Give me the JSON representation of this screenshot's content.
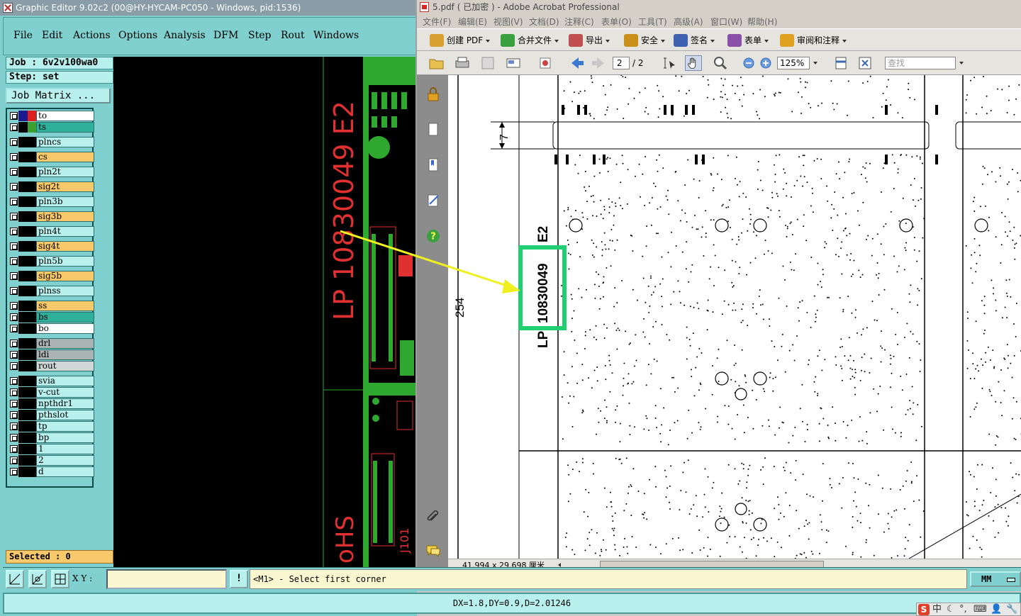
{
  "ge": {
    "title": "Graphic Editor 9.02c2 (00@HY-HYCAM-PC050 - Windows, pid:1536)",
    "menu": [
      {
        "label": "File",
        "name": "menu-file"
      },
      {
        "label": "Edit",
        "name": "menu-edit"
      },
      {
        "label": "Actions",
        "name": "menu-actions"
      },
      {
        "label": "Options",
        "name": "menu-options"
      },
      {
        "label": "Analysis",
        "name": "menu-analysis"
      },
      {
        "label": "DFM",
        "name": "menu-dfm"
      },
      {
        "label": "Step",
        "name": "menu-step"
      },
      {
        "label": "Rout",
        "name": "menu-rout"
      },
      {
        "label": "Windows",
        "name": "menu-windows"
      }
    ],
    "job_label": "Job : 6v2v100wa0",
    "step_label": "Step: set",
    "job_matrix_button": "Job Matrix ...",
    "layers": [
      {
        "name": "to",
        "bg": "#ffffff",
        "sw1": "#1a1a8c",
        "sw2": "#e02020"
      },
      {
        "name": "ts",
        "bg": "#2fb09a",
        "sw1": "#000000",
        "sw2": "#3aa030"
      },
      {
        "name": "plncs",
        "bg": "#b8f0ee",
        "sw1": "#000000",
        "sw2": "#000000"
      },
      {
        "name": "cs",
        "bg": "#f8c96a",
        "sw1": "#000000",
        "sw2": "#000000"
      },
      {
        "name": "pln2t",
        "bg": "#b8f0ee",
        "sw1": "#000000",
        "sw2": "#000000"
      },
      {
        "name": "sig2t",
        "bg": "#f8c96a",
        "sw1": "#000000",
        "sw2": "#000000"
      },
      {
        "name": "pln3b",
        "bg": "#b8f0ee",
        "sw1": "#000000",
        "sw2": "#000000"
      },
      {
        "name": "sig3b",
        "bg": "#f8c96a",
        "sw1": "#000000",
        "sw2": "#000000"
      },
      {
        "name": "pln4t",
        "bg": "#b8f0ee",
        "sw1": "#000000",
        "sw2": "#000000"
      },
      {
        "name": "sig4t",
        "bg": "#f8c96a",
        "sw1": "#000000",
        "sw2": "#000000"
      },
      {
        "name": "pln5b",
        "bg": "#b8f0ee",
        "sw1": "#000000",
        "sw2": "#000000"
      },
      {
        "name": "sig5b",
        "bg": "#f8c96a",
        "sw1": "#000000",
        "sw2": "#000000"
      },
      {
        "name": "plnss",
        "bg": "#b8f0ee",
        "sw1": "#000000",
        "sw2": "#000000"
      },
      {
        "name": "ss",
        "bg": "#f8c96a",
        "sw1": "#000000",
        "sw2": "#000000"
      },
      {
        "name": "bs",
        "bg": "#2fb09a",
        "sw1": "#000000",
        "sw2": "#000000"
      },
      {
        "name": "bo",
        "bg": "#ffffff",
        "sw1": "#000000",
        "sw2": "#000000"
      },
      {
        "name": "drl",
        "bg": "#a9b3b3",
        "sw1": "#000000",
        "sw2": "#000000"
      },
      {
        "name": "ldi",
        "bg": "#a9b3b3",
        "sw1": "#000000",
        "sw2": "#000000"
      },
      {
        "name": "rout",
        "bg": "#d0d6d6",
        "sw1": "#000000",
        "sw2": "#000000"
      },
      {
        "name": "svia",
        "bg": "#b8f0ee",
        "sw1": "#000000",
        "sw2": "#000000"
      },
      {
        "name": "v-cut",
        "bg": "#b8f0ee",
        "sw1": "#000000",
        "sw2": "#000000"
      },
      {
        "name": "npthdr1",
        "bg": "#b8f0ee",
        "sw1": "#000000",
        "sw2": "#000000"
      },
      {
        "name": "pthslot",
        "bg": "#b8f0ee",
        "sw1": "#000000",
        "sw2": "#000000"
      },
      {
        "name": "tp",
        "bg": "#b8f0ee",
        "sw1": "#000000",
        "sw2": "#000000"
      },
      {
        "name": "bp",
        "bg": "#b8f0ee",
        "sw1": "#000000",
        "sw2": "#000000"
      },
      {
        "name": "1",
        "bg": "#b8f0ee",
        "sw1": "#000000",
        "sw2": "#000000"
      },
      {
        "name": "2",
        "bg": "#b8f0ee",
        "sw1": "#000000",
        "sw2": "#000000"
      },
      {
        "name": "d",
        "bg": "#b8f0ee",
        "sw1": "#000000",
        "sw2": "#000000"
      }
    ],
    "selected_label": "Selected : 0",
    "canvas_text_main": "LP 10830049 E2",
    "canvas_text_bottom": "oHS",
    "canvas_text_j101": "J101",
    "xy_label": "X Y :",
    "xy_value": "",
    "bang": "!",
    "prompt": "<M1> - Select first corner",
    "units": "MM",
    "measure": "DX=1.8,DY=0.9,D=2.01246"
  },
  "tray": {
    "logo": "S",
    "ime": "中"
  },
  "acrobat": {
    "title": "5.pdf ( 已加密 ) - Adobe Acrobat Professional",
    "menu": [
      {
        "label": "文件(F)",
        "name": "menu-file"
      },
      {
        "label": "编辑(E)",
        "name": "menu-edit"
      },
      {
        "label": "视图(V)",
        "name": "menu-view"
      },
      {
        "label": "文档(D)",
        "name": "menu-document"
      },
      {
        "label": "注释(C)",
        "name": "menu-comments"
      },
      {
        "label": "表单(O)",
        "name": "menu-forms"
      },
      {
        "label": "工具(T)",
        "name": "menu-tools"
      },
      {
        "label": "高级(A)",
        "name": "menu-advanced"
      },
      {
        "label": "窗口(W)",
        "name": "menu-window"
      },
      {
        "label": "帮助(H)",
        "name": "menu-help"
      }
    ],
    "toolbar1": [
      {
        "label": "创建 PDF",
        "name": "create-pdf-button",
        "color": "#d8a030"
      },
      {
        "label": "合并文件",
        "name": "combine-files-button",
        "color": "#3aa040"
      },
      {
        "label": "导出",
        "name": "export-button",
        "color": "#c05050"
      },
      {
        "label": "安全",
        "name": "security-button",
        "color": "#c89018"
      },
      {
        "label": "签名",
        "name": "sign-button",
        "color": "#4060b0"
      },
      {
        "label": "表单",
        "name": "forms-button",
        "color": "#8a50a8"
      },
      {
        "label": "审阅和注释",
        "name": "review-comment-button",
        "color": "#e0a020"
      }
    ],
    "page_current": "2",
    "page_total": "/ 2",
    "zoom": "125%",
    "search_placeholder": "查找",
    "page_size": "41.994 x 29.698 厘米",
    "doc_text_lp": "LP",
    "doc_text_num": "10830049",
    "doc_text_e2": "E2",
    "doc_dim_254": "254",
    "doc_dim_7": "7"
  },
  "colors": {
    "annotation_arrow": "#f0f020",
    "highlight_box": "#20d070",
    "pcb_green": "#2fa82f",
    "pcb_red": "#e03030"
  }
}
